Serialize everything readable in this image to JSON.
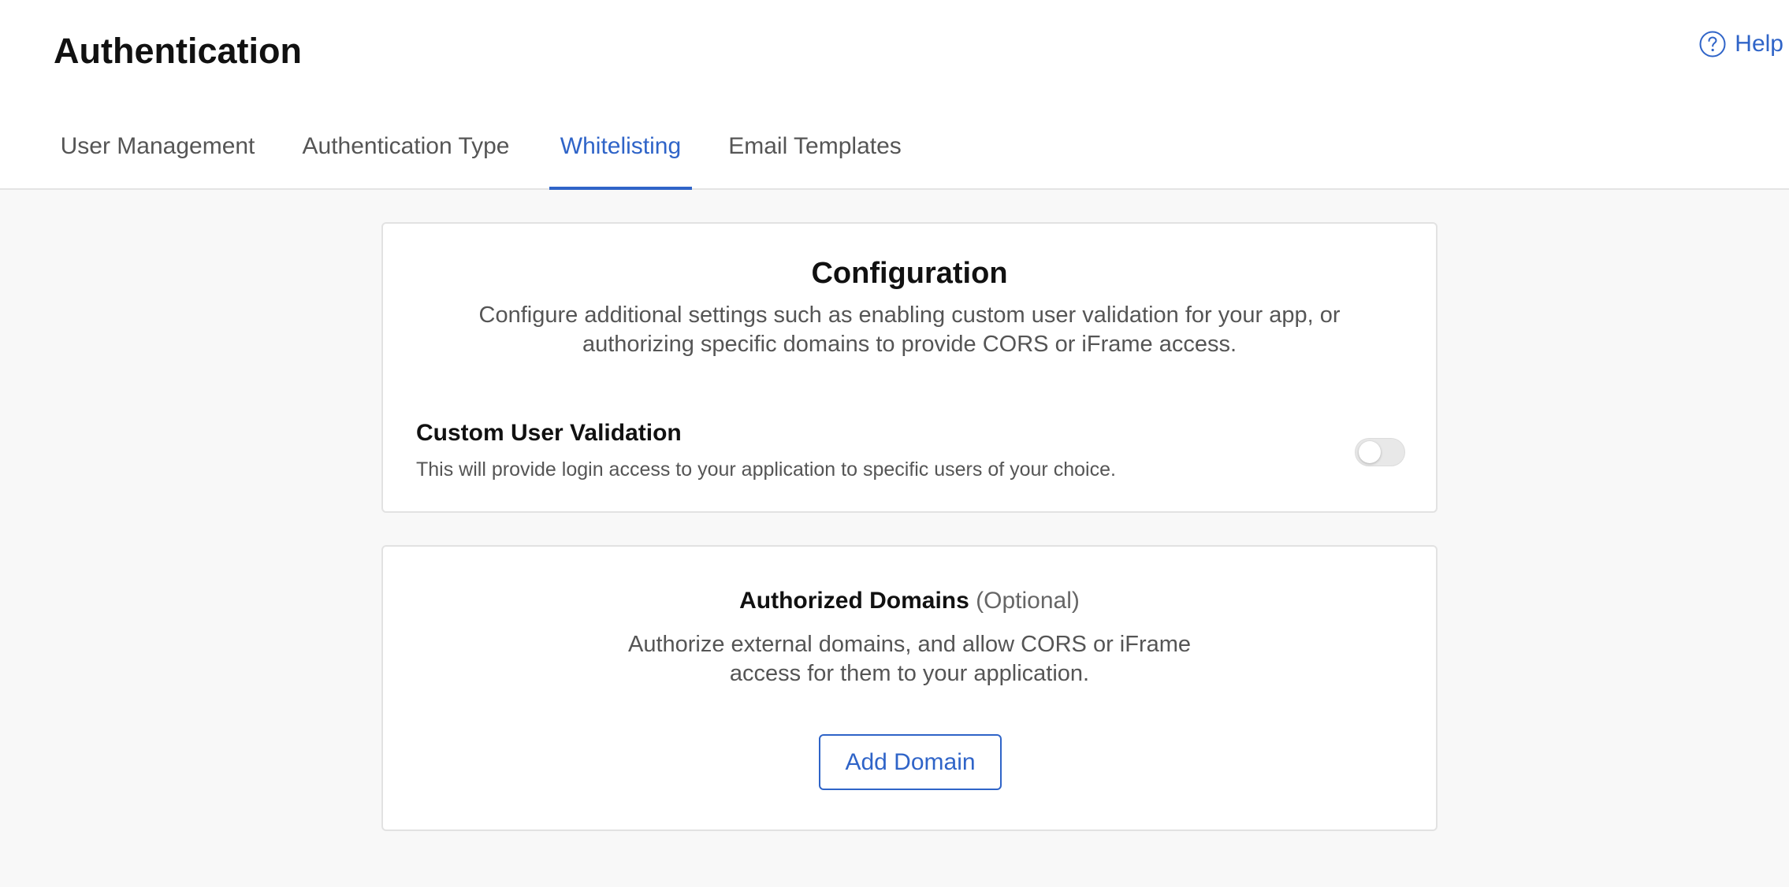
{
  "header": {
    "title": "Authentication",
    "help_label": "Help"
  },
  "tabs": [
    {
      "label": "User Management",
      "active": false
    },
    {
      "label": "Authentication Type",
      "active": false
    },
    {
      "label": "Whitelisting",
      "active": true
    },
    {
      "label": "Email Templates",
      "active": false
    }
  ],
  "configuration": {
    "title": "Configuration",
    "description": "Configure additional settings such as enabling custom user validation for your app, or authorizing specific domains to provide CORS or iFrame access.",
    "custom_user_validation": {
      "title": "Custom User Validation",
      "description": "This will provide login access to your application to specific users of your choice.",
      "enabled": false
    }
  },
  "authorized_domains": {
    "title": "Authorized Domains",
    "optional_label": "(Optional)",
    "description": "Authorize external domains, and allow CORS or iFrame access for them to your application.",
    "add_button_label": "Add Domain"
  },
  "icons": {
    "help": "help-circle-icon"
  },
  "colors": {
    "accent": "#2f64c8",
    "background": "#f8f8f8",
    "card_border": "#e2e2e2"
  }
}
